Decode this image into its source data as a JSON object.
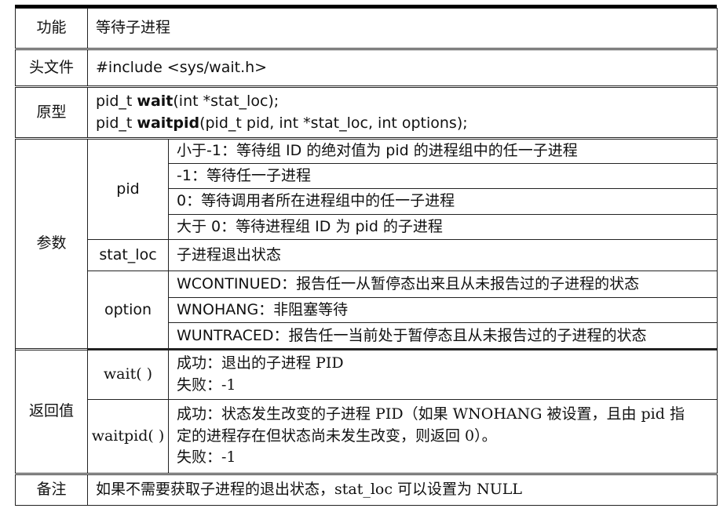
{
  "rows": {
    "function": {
      "label": "功能",
      "value": "等待子进程"
    },
    "header": {
      "label": "头文件",
      "value": "#include <sys/wait.h>"
    },
    "prototype": {
      "label": "原型",
      "line1": {
        "prefix": "pid_t ",
        "name": "wait",
        "suffix": "(int *stat_loc);"
      },
      "line2": {
        "prefix": "pid_t ",
        "name": "waitpid",
        "suffix": "(pid_t pid, int *stat_loc, int options);"
      }
    },
    "params": {
      "label": "参数",
      "pid": {
        "label": "pid",
        "items": [
          "小于-1：等待组 ID 的绝对值为 pid 的进程组中的任一子进程",
          "-1：等待任一子进程",
          "0：等待调用者所在进程组中的任一子进程",
          "大于 0：等待进程组 ID 为 pid 的子进程"
        ]
      },
      "stat_loc": {
        "label": "stat_loc",
        "value": "子进程退出状态"
      },
      "option": {
        "label": "option",
        "items": [
          "WCONTINUED：报告任一从暂停态出来且从未报告过的子进程的状态",
          "WNOHANG：非阻塞等待",
          "WUNTRACED：报告任一当前处于暂停态且从未报告过的子进程的状态"
        ]
      }
    },
    "returns": {
      "label": "返回值",
      "wait": {
        "label": "wait( )",
        "lines": [
          "成功：退出的子进程 PID",
          "失败：-1"
        ]
      },
      "waitpid": {
        "label": "waitpid( )",
        "lines": [
          "成功：状态发生改变的子进程 PID（如果 WNOHANG 被设置，且由 pid 指",
          "定的进程存在但状态尚未发生改变，则返回 0）。",
          "失败：-1"
        ]
      }
    },
    "notes": {
      "label": "备注",
      "value": "如果不需要获取子进程的退出状态，stat_loc 可以设置为 NULL"
    }
  }
}
